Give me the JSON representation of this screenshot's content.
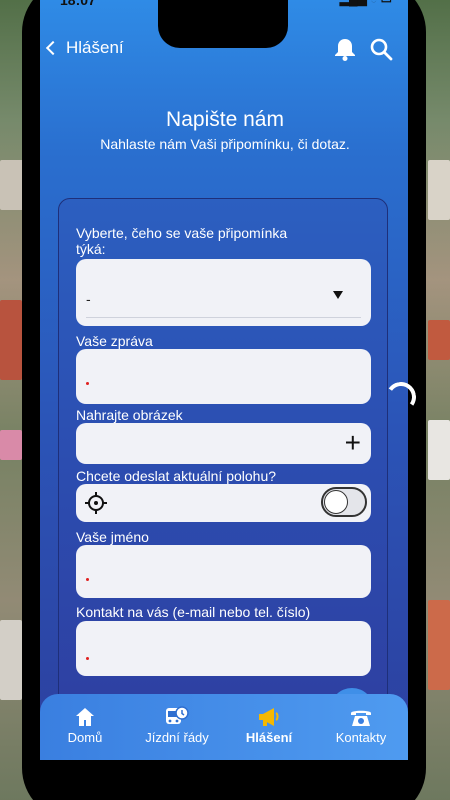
{
  "status": {
    "time": "18:07",
    "icons": "▂▄▆ ◔ ▭"
  },
  "nav": {
    "back_label": "Hlášení"
  },
  "header": {
    "title": "Napište nám",
    "subtitle": "Nahlaste nám Vaši připomínku, či dotaz."
  },
  "form": {
    "topic_label": "Vyberte, čeho se vaše připomínka týká:",
    "topic_value": "-",
    "message_label": "Vaše zpráva",
    "image_label": "Nahrajte obrázek",
    "location_label": "Chcete odeslat aktuální polohu?",
    "location_enabled": false,
    "name_label": "Vaše jméno",
    "contact_label": "Kontakt na vás (e-mail nebo tel. číslo)"
  },
  "tabs": [
    {
      "label": "Domů",
      "icon": "home-icon"
    },
    {
      "label": "Jízdní řády",
      "icon": "bus-clock-icon"
    },
    {
      "label": "Hlášení",
      "icon": "megaphone-icon",
      "active": true
    },
    {
      "label": "Kontakty",
      "icon": "phone-icon"
    }
  ],
  "colors": {
    "accent": "#2f8be6",
    "active_tab_icon": "#f5b800"
  }
}
